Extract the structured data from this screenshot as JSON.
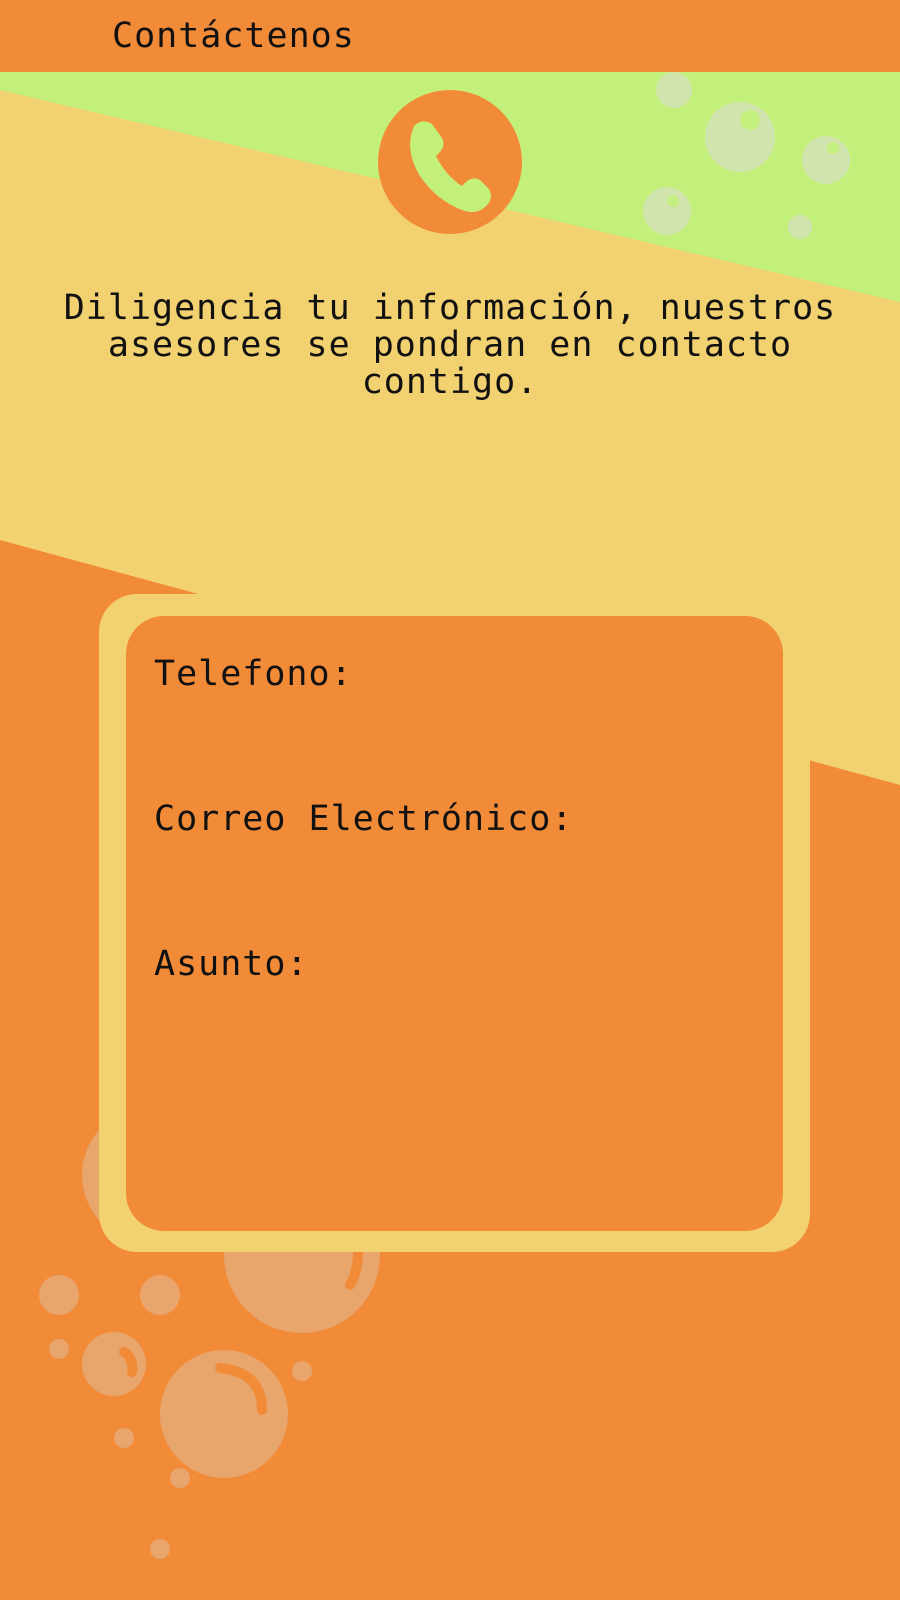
{
  "header": {
    "title": "Contáctenos"
  },
  "hero": {
    "icon": "phone-icon",
    "intro_text": "Diligencia tu información, nuestros asesores se pondran en contacto contigo."
  },
  "form": {
    "phone_label": "Telefono:",
    "phone_value": "",
    "email_label": "Correo Electrónico:",
    "email_value": "",
    "subject_label": "Asunto:",
    "subject_value": ""
  },
  "colors": {
    "orange": "#F28B38",
    "yellow": "#F2D170",
    "green": "#C3F07A",
    "bubble": "#E8A56C"
  }
}
